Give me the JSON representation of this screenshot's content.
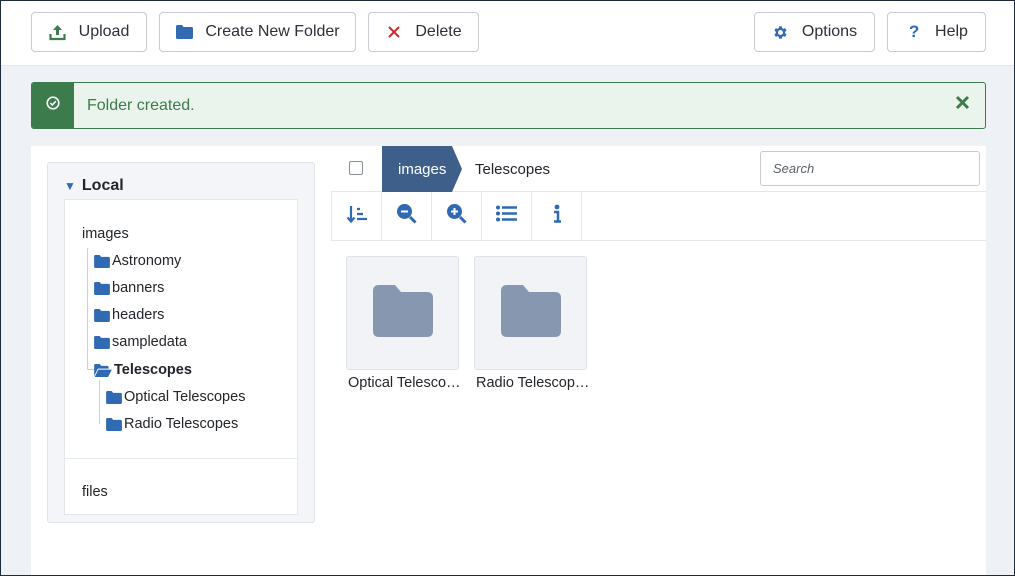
{
  "toolbar": {
    "upload": {
      "label": "Upload",
      "icon": "upload-icon"
    },
    "new_folder": {
      "label": "Create New Folder",
      "icon": "folder-icon"
    },
    "delete": {
      "label": "Delete",
      "icon": "close-icon"
    },
    "options": {
      "label": "Options",
      "icon": "gear-icon"
    },
    "help": {
      "label": "Help",
      "icon": "question-icon"
    }
  },
  "alert": {
    "message": "Folder created.",
    "type": "success",
    "color": "#3b7b4c"
  },
  "tree": {
    "header": "Local",
    "root": "images",
    "items": [
      {
        "label": "Astronomy"
      },
      {
        "label": "banners"
      },
      {
        "label": "headers"
      },
      {
        "label": "sampledata"
      },
      {
        "label": "Telescopes",
        "expanded": true,
        "selected": true
      },
      {
        "label": "Optical Telescopes"
      },
      {
        "label": "Radio Telescopes"
      }
    ],
    "second_root": "files"
  },
  "breadcrumb": {
    "items": [
      "images",
      "Telescopes"
    ]
  },
  "search": {
    "placeholder": "Search",
    "value": ""
  },
  "tools": [
    "sort-icon",
    "zoom-out-icon",
    "zoom-in-icon",
    "list-view-icon",
    "info-icon"
  ],
  "folders": [
    {
      "label": "Optical Telesco…",
      "full_name": "Optical Telescopes"
    },
    {
      "label": "Radio Telescop…",
      "full_name": "Radio Telescopes"
    }
  ],
  "colors": {
    "accent": "#2f6ab2",
    "breadcrumb_active": "#3e5f8a",
    "folder_tile": "#8897b0",
    "delete": "#d0272d"
  }
}
